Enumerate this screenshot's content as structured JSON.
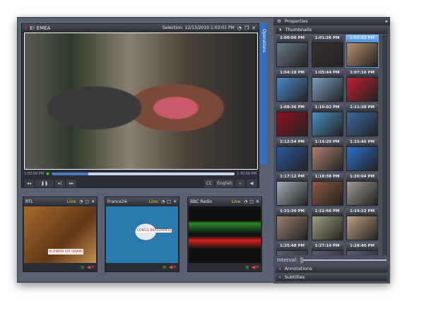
{
  "player": {
    "title": "E! EMEA",
    "selection": "Selection: 12/13/2010 1:03:01 PM",
    "start_time": "1:00:00 PM",
    "end_time": "1:30:00 PM",
    "language": "English",
    "cc": "CC",
    "progress_percent": 22
  },
  "operations_tab": "Operations",
  "tiles": [
    {
      "name": "RTL",
      "live": "Live:",
      "color": "#c8702a",
      "overlay": "BLEIBEN SIE DRAN!"
    },
    {
      "name": "France24",
      "live": "Live:",
      "color": "#2a7ab0",
      "overlay": "CONGO BRAZZAVILLE"
    },
    {
      "name": "BBC Radio",
      "live": "Live:",
      "color": "#111111",
      "overlay": ""
    }
  ],
  "right_panel": {
    "properties": "Properties",
    "thumbnails": "Thumbnails",
    "interval": "Interval:",
    "annotations": "Annotations",
    "subtitles": "Subtitles",
    "thumbs": [
      "1:00:00 PM",
      "1:01:26 PM",
      "1:02:52 PM",
      "1:04:18 PM",
      "1:05:44 PM",
      "1:07:10 PM",
      "1:08:36 PM",
      "1:10:02 PM",
      "1:11:28 PM",
      "1:12:54 PM",
      "1:14:20 PM",
      "1:15:46 PM",
      "1:17:12 PM",
      "1:18:38 PM",
      "1:20:04 PM",
      "1:21:30 PM",
      "1:22:56 PM",
      "1:24:22 PM",
      "1:25:48 PM",
      "1:27:14 PM",
      "1:28:40 PM"
    ],
    "selected_thumb": "1:02:52 PM"
  },
  "colors": {
    "accent": "#2f6fc8",
    "live": "#e6d23a"
  }
}
